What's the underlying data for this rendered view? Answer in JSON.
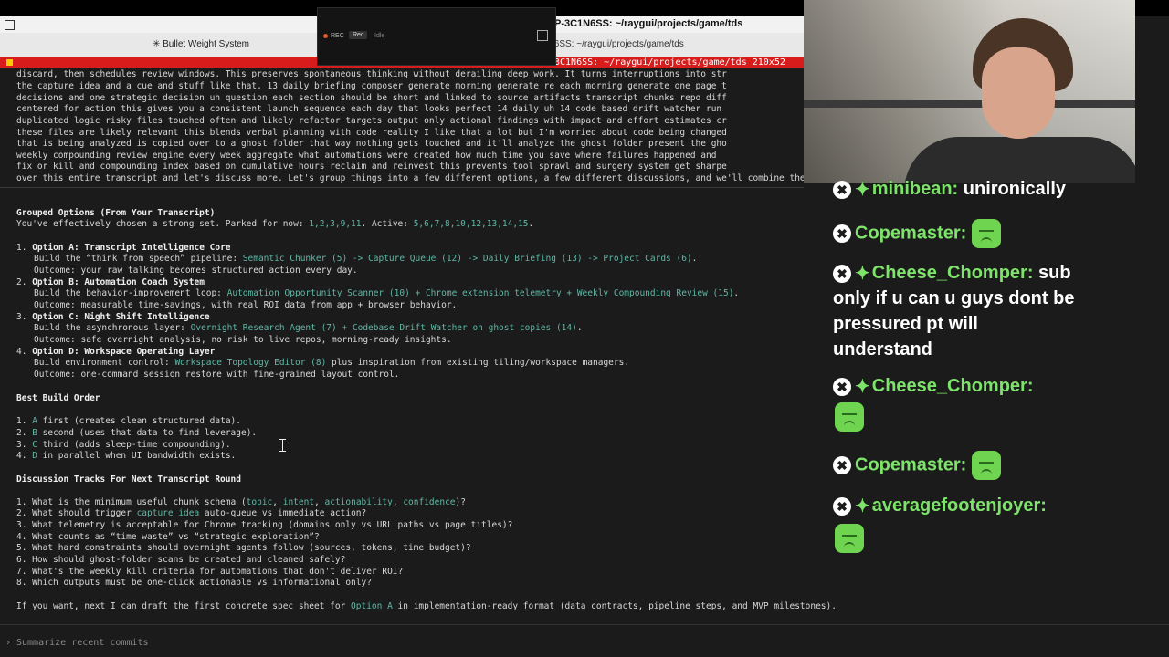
{
  "window": {
    "title": "P-3C1N6SS: ~/raygui/projects/game/tds",
    "tabs": [
      {
        "label": "✳ Bullet Weight System"
      },
      {
        "label": "P-3C1N6SS: ~/raygui/projects/game/tds"
      }
    ],
    "session_bar": "3C1N6SS: ~/raygui/projects/game/tds 210x52"
  },
  "recorder": {
    "status": "REC",
    "button": "Rec",
    "mode": "Idle"
  },
  "transcript_lines": [
    "discard, then schedules review windows. This preserves spontaneous thinking without derailing deep work. It turns interruptions into str",
    "the capture idea and a cue and stuff like that. 13 daily briefing composer generate morning generate re each morning generate one page t",
    "decisions and one strategic decision uh question each section should be short and linked to source artifacts transcript chunks repo diff",
    "centered for action this gives you a consistent launch sequence each day that looks perfect 14 daily uh 14 code based drift watcher run",
    "duplicated logic risky files touched often and likely refactor targets output only actional findings with impact and effort estimates cr",
    "these files are likely relevant this blends verbal planning with code reality I like that a lot but I'm worried about code being changed",
    "that is being analyzed is copied over to a ghost folder that way nothing gets touched and it'll analyze the ghost folder present the gho",
    "weekly compounding review engine every week aggregate what automations were created how much time you save where failures happened and",
    "fix or kill and compounding index based on cumulative hours reclaim and reinvest this prevents tool sprawl and surgery system get sharpe",
    "over this entire transcript and let's discuss more. Let's group things into a few different options, a few different discussions, and we'll combine the transcription stash analyzation process."
  ],
  "grouped": {
    "heading": "Grouped Options (From Your Transcript)",
    "intro_pre": "You've effectively chosen a strong set. Parked for now: ",
    "parked": "1,2,3,9,11",
    "intro_mid": ". Active: ",
    "active": "5,6,7,8,10,12,13,14,15",
    "intro_end": ".",
    "options": [
      {
        "num": "1.",
        "title": "Option A: Transcript Intelligence Core",
        "build_pre": "Build the “think from speech” pipeline: ",
        "build_hl": "Semantic Chunker (5) -> Capture Queue (12) -> Daily Briefing (13) -> Project Cards (6)",
        "build_post": ".",
        "outcome": "Outcome: your raw talking becomes structured action every day."
      },
      {
        "num": "2.",
        "title": "Option B: Automation Coach System",
        "build_pre": "Build the behavior-improvement loop: ",
        "build_hl": "Automation Opportunity Scanner (10) + Chrome extension telemetry + Weekly Compounding Review (15)",
        "build_post": ".",
        "outcome": "Outcome: measurable time-savings, with real ROI data from app + browser behavior."
      },
      {
        "num": "3.",
        "title": "Option C: Night Shift Intelligence",
        "build_pre": "Build the asynchronous layer: ",
        "build_hl": "Overnight Research Agent (7) + Codebase Drift Watcher on ghost copies (14)",
        "build_post": ".",
        "outcome": "Outcome: safe overnight analysis, no risk to live repos, morning-ready insights."
      },
      {
        "num": "4.",
        "title": "Option D: Workspace Operating Layer",
        "build_pre": "Build environment control: ",
        "build_hl": "Workspace Topology Editor (8)",
        "build_post": " plus inspiration from existing tiling/workspace managers.",
        "outcome": "Outcome: one-command session restore with fine-grained layout control."
      }
    ]
  },
  "build_order": {
    "heading": "Best Build Order",
    "items": [
      {
        "num": "1.",
        "key": "A",
        "text": " first (creates clean structured data)."
      },
      {
        "num": "2.",
        "key": "B",
        "text": " second (uses that data to find leverage)."
      },
      {
        "num": "3.",
        "key": "C",
        "text": " third (adds sleep-time compounding)."
      },
      {
        "num": "4.",
        "key": "D",
        "text": " in parallel when UI bandwidth exists."
      }
    ]
  },
  "discussion": {
    "heading": "Discussion Tracks For Next Transcript Round",
    "q1_pre": "1. What is the minimum useful chunk schema (",
    "q1_a": "topic",
    "q1_b": "intent",
    "q1_c": "actionability",
    "q1_d": "confidence",
    "q1_post": ")?",
    "q2_pre": "2. What should trigger ",
    "q2_hl": "capture idea",
    "q2_post": " auto-queue vs immediate action?",
    "rest": [
      "3. What telemetry is acceptable for Chrome tracking (domains only vs URL paths vs page titles)?",
      "4. What counts as “time waste” vs “strategic exploration”?",
      "5. What hard constraints should overnight agents follow (sources, tokens, time budget)?",
      "6. How should ghost-folder scans be created and cleaned safely?",
      "7. What's the weekly kill criteria for automations that don't deliver ROI?",
      "8. Which outputs must be one-click actionable vs informational only?"
    ]
  },
  "closing": {
    "pre": "If you want, next I can draft the first concrete spec sheet for ",
    "hl": "Option A",
    "post": " in implementation-ready format (data contracts, pipeline steps, and MVP milestones)."
  },
  "prompt": {
    "caret": "›",
    "placeholder": "Summarize recent commits"
  },
  "chat": [
    {
      "user": "minibean:",
      "text": "unironically",
      "star": true
    },
    {
      "user": "Copemaster:",
      "text": "",
      "star": false,
      "emote": "sad-emote"
    },
    {
      "user": "Cheese_Chomper:",
      "text": "sub",
      "star": true
    },
    {
      "cont": "only if u can u guys dont be"
    },
    {
      "cont": "pressured pt will"
    },
    {
      "cont": "understand"
    },
    {
      "user": "Cheese_Chomper:",
      "text": "",
      "star": true
    },
    {
      "user": "Copemaster:",
      "text": "",
      "star": false
    },
    {
      "user": "averagefootenjoyer:",
      "text": "",
      "star": true
    }
  ],
  "chat_badge": "✖",
  "chat_star": "✦"
}
